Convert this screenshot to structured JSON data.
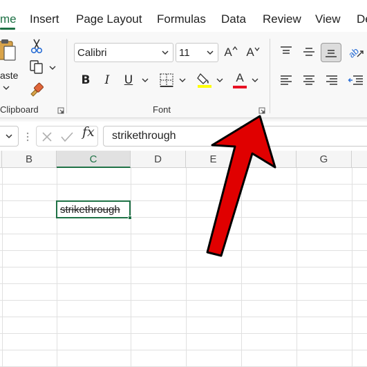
{
  "menu": {
    "tabs": [
      {
        "label": "me",
        "active": true
      },
      {
        "label": "Insert"
      },
      {
        "label": "Page Layout"
      },
      {
        "label": "Formulas"
      },
      {
        "label": "Data"
      },
      {
        "label": "Review"
      },
      {
        "label": "View"
      },
      {
        "label": "De"
      }
    ]
  },
  "ribbon": {
    "clipboard": {
      "group_label": "Clipboard",
      "paste_label": "aste",
      "cut_icon": "scissors-icon",
      "copy_icon": "copy-icon",
      "format_painter_icon": "format-painter-icon"
    },
    "font": {
      "group_label": "Font",
      "font_name": "Calibri",
      "font_size": "11",
      "grow_label": "A",
      "shrink_label": "A",
      "bold": "B",
      "italic": "I",
      "underline": "U",
      "font_color_letter": "A",
      "font_color": "#e81123",
      "highlight_color": "#ffff00"
    },
    "alignment": {
      "icons": [
        "align-top-icon",
        "align-middle-icon",
        "align-bottom-icon",
        "orientation-icon",
        "align-left-icon",
        "align-center-icon",
        "align-right-icon",
        "decrease-indent-icon"
      ]
    }
  },
  "formula_bar": {
    "fx_label": "fx",
    "content": "strikethrough"
  },
  "grid": {
    "columns": [
      "B",
      "C",
      "D",
      "E",
      "G"
    ],
    "selected_column": "C",
    "active_cell_text": "strikethrough"
  },
  "annotation": {
    "arrow_color": "#e00000"
  }
}
